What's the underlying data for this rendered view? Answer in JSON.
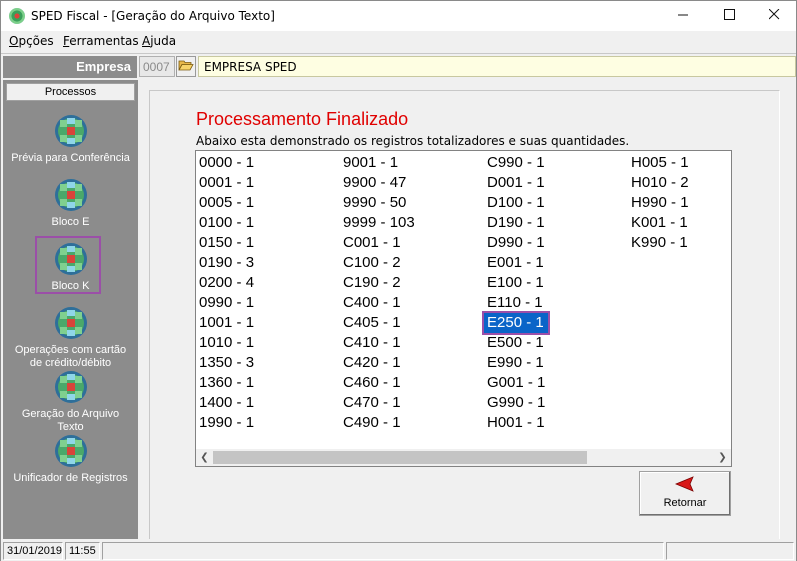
{
  "window": {
    "title": "SPED Fiscal - [Geração do Arquivo Texto]",
    "controls": {
      "minimize": "—",
      "maximize": "☐",
      "close": "✕"
    }
  },
  "menu": {
    "items": [
      {
        "label": "Opções",
        "accel": "O"
      },
      {
        "label": "Ferramentas",
        "accel": "F"
      },
      {
        "label": "Ajuda",
        "accel": "A"
      }
    ]
  },
  "empresa": {
    "label": "Empresa",
    "code": "0007",
    "name": "EMPRESA SPED"
  },
  "sidebar": {
    "header": "Processos",
    "items": [
      {
        "label": "Prévia para Conferência",
        "icon": "process-globe-icon"
      },
      {
        "label": "Bloco E",
        "icon": "process-globe-icon"
      },
      {
        "label": "Bloco K",
        "icon": "process-globe-icon",
        "selected": true
      },
      {
        "label": "Operações com cartão de crédito/débito",
        "icon": "process-globe-icon"
      },
      {
        "label": "Geração do Arquivo Texto",
        "icon": "process-globe-icon"
      },
      {
        "label": "Unificador de Registros",
        "icon": "process-globe-icon"
      }
    ]
  },
  "main": {
    "title": "Processamento Finalizado",
    "subtitle": "Abaixo esta demonstrado os registros totalizadores e suas quantidades.",
    "columns": [
      [
        "0000 - 1",
        "0001 - 1",
        "0005 - 1",
        "0100 - 1",
        "0150 - 1",
        "0190 - 3",
        "0200 - 4",
        "0990 - 1",
        "1001 - 1",
        "1010 - 1",
        "1350 - 3",
        "1360 - 1",
        "1400 - 1",
        "1990 - 1"
      ],
      [
        "9001 - 1",
        "9900 - 47",
        "9990 - 50",
        "9999 - 103",
        "C001 - 1",
        "C100 - 2",
        "C190 - 2",
        "C400 - 1",
        "C405 - 1",
        "C410 - 1",
        "C420 - 1",
        "C460 - 1",
        "C470 - 1",
        "C490 - 1"
      ],
      [
        "C990 - 1",
        "D001 - 1",
        "D100 - 1",
        "D190 - 1",
        "D990 - 1",
        "E001 - 1",
        "E100 - 1",
        "E110 - 1",
        "E250 - 1",
        "E500 - 1",
        "E990 - 1",
        "G001 - 1",
        "G990 - 1",
        "H001 - 1"
      ],
      [
        "H005 - 1",
        "H010 - 2",
        "H990 - 1",
        "K001 - 1",
        "K990 - 1"
      ]
    ],
    "highlighted": "E250 - 1",
    "retornar_label": "Retornar"
  },
  "status": {
    "date": "31/01/2019",
    "time": "11:55"
  },
  "colors": {
    "title_red": "#e00000",
    "sidebar_gray": "#8c8c8c",
    "selection_blue": "#0a64c8",
    "highlight_frame": "#9b4fa8",
    "empresa_name_bg": "#fefee2"
  }
}
